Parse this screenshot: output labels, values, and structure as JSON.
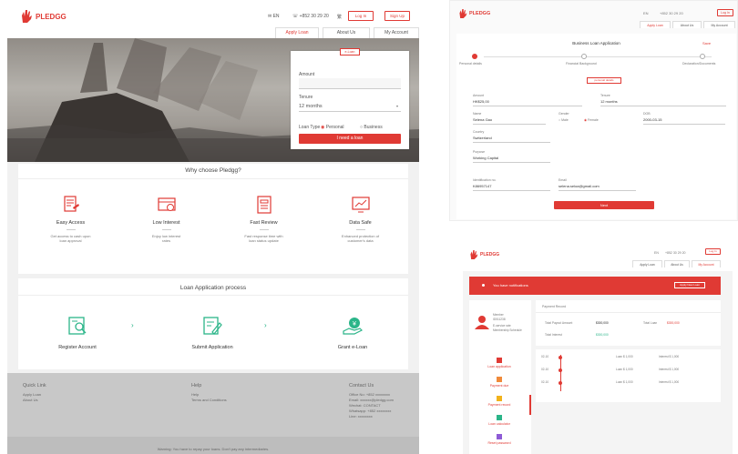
{
  "brand": {
    "name": "PLEDGG",
    "accent": "#e03a34",
    "green": "#2bb589"
  },
  "header": {
    "lang": "EN",
    "phone": "+852 30 29 20",
    "login": "Log In",
    "signup": "Sign Up",
    "tabs": [
      "Apply Loan",
      "About Us",
      "My Account"
    ]
  },
  "hero": {
    "form_tag": "e-Loan",
    "amount_label": "Amount",
    "tenure_label": "Tenure",
    "tenure_value": "12 months",
    "loan_type_label": "Loan Type",
    "opt_personal": "Personal",
    "opt_business": "Business",
    "cta": "I need a loan"
  },
  "why": {
    "title": "Why choose Pledgg?",
    "items": [
      {
        "title": "Easy Access",
        "desc1": "Get access to cash upon",
        "desc2": "loan approval",
        "icon": "document-icon"
      },
      {
        "title": "Low Interest",
        "desc1": "Enjoy low interest",
        "desc2": "rates",
        "icon": "card-icon"
      },
      {
        "title": "Fast Review",
        "desc1": "Fast response time with",
        "desc2": "loan status update",
        "icon": "form-icon"
      },
      {
        "title": "Data Safe",
        "desc1": "Enhanced protection of",
        "desc2": "customer's data",
        "icon": "monitor-chart-icon"
      }
    ]
  },
  "process": {
    "title": "Loan Application process",
    "steps": [
      {
        "label": "Register Account",
        "icon": "user-card-icon"
      },
      {
        "label": "Submit Application",
        "icon": "edit-document-icon"
      },
      {
        "label": "Grant e-Loan",
        "icon": "money-hand-icon"
      }
    ]
  },
  "footer": {
    "quick": {
      "title": "Quick Link",
      "links": [
        "Apply Loan",
        "About Us"
      ]
    },
    "help": {
      "title": "Help",
      "links": [
        "Help",
        "Terms and Conditions"
      ]
    },
    "contact": {
      "title": "Contact Us",
      "lines": [
        "Office No: +852 xxxxxxxx",
        "Email: xxxxxx@pledgg.com",
        "Wechat: CONTACT",
        "Whatsapp: +852 xxxxxxxx",
        "Line: xxxxxxxx"
      ]
    },
    "bottom": "Warning: You have to repay your loans. Don't pay any intermediaries."
  },
  "app": {
    "title": "Business Loan Application",
    "save": "Save",
    "steps": [
      "Personal details",
      "Financial Background",
      "Declaration/Documents"
    ],
    "section_chip": "personal details",
    "amount_label": "Amount",
    "amount_value": "HK$25,00",
    "tenure_label": "Tenure",
    "tenure_value": "12 months",
    "name_label": "Name",
    "name_value": "Selena Gao",
    "gender_label": "Gender",
    "male": "Male",
    "female": "Female",
    "dob_label": "DOB",
    "dob_value": "2000-03-15",
    "country_label": "Country",
    "country_value": "Switzerland",
    "purpose_label": "Purpose",
    "purpose_value": "Working Capital",
    "id_label": "Identification no.",
    "id_value": "K86957147",
    "email_label": "Email",
    "email_value": "selena.seloa@gmail.com",
    "next": "Next"
  },
  "dash": {
    "notification": "You have notifications",
    "apply_new": "Apply New Loan",
    "user_name": "Member",
    "user_id": "ID511238",
    "user_role1": "E-service rate",
    "user_role2": "Membership Schedule",
    "payment_title": "Payment Record",
    "total_payout_label": "Total Payout Amount",
    "total_payout_value": "$300,000",
    "total_loan_label": "Total Loan",
    "total_loan_value": "$300,000",
    "total_interest_label": "Total Interest",
    "total_interest_value": "$300,000",
    "menu": [
      "Loan application",
      "Payment due",
      "Payment record",
      "Loan calculator",
      "Reset password"
    ],
    "records": [
      {
        "date": "02-10",
        "loan": "Loan $ 1,000",
        "interest": "Interest $ 1,000"
      },
      {
        "date": "02-10",
        "loan": "Loan $ 1,000",
        "interest": "Interest $ 1,000"
      },
      {
        "date": "02-10",
        "loan": "Loan $ 1,000",
        "interest": "Interest $ 1,000"
      }
    ]
  }
}
